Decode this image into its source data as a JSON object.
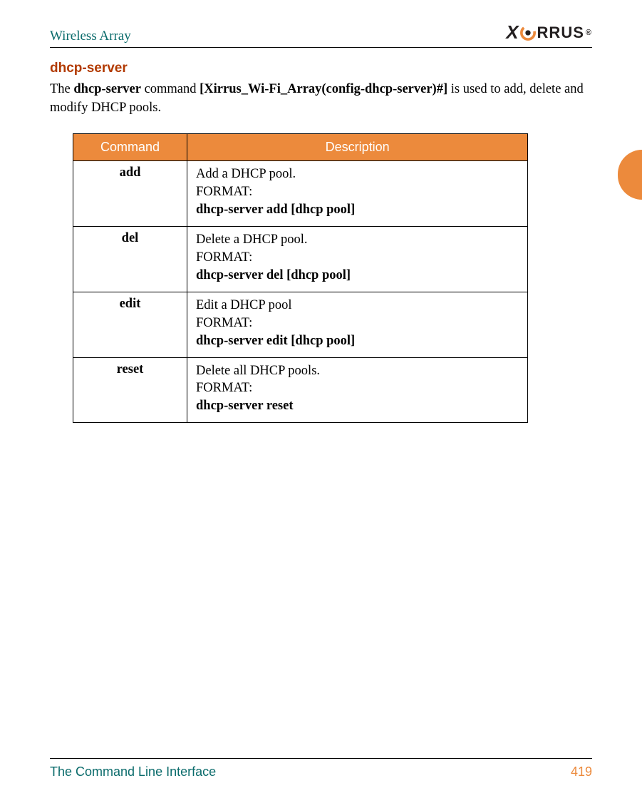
{
  "header": {
    "title": "Wireless Array",
    "logo_text_1": "X",
    "logo_text_2": "RRUS",
    "logo_reg": "®"
  },
  "section": {
    "title": "dhcp-server",
    "intro_pre": "The ",
    "intro_cmd": "dhcp-server",
    "intro_mid": " command ",
    "intro_prompt": "[Xirrus_Wi-Fi_Array(config-dhcp-server)#]",
    "intro_post": " is used to add, delete and modify DHCP pools."
  },
  "table": {
    "headers": {
      "command": "Command",
      "description": "Description"
    },
    "rows": [
      {
        "command": "add",
        "desc1": "Add a DHCP pool.",
        "desc2": "FORMAT:",
        "desc3": "dhcp-server add [dhcp pool]"
      },
      {
        "command": "del",
        "desc1": "Delete a DHCP pool.",
        "desc2": "FORMAT:",
        "desc3": "dhcp-server del [dhcp pool]"
      },
      {
        "command": "edit",
        "desc1": "Edit a DHCP pool",
        "desc2": "FORMAT:",
        "desc3": "dhcp-server edit [dhcp pool]"
      },
      {
        "command": "reset",
        "desc1": "Delete all DHCP pools.",
        "desc2": "FORMAT:",
        "desc3": "dhcp-server reset"
      }
    ]
  },
  "footer": {
    "section": "The Command Line Interface",
    "page": "419"
  }
}
